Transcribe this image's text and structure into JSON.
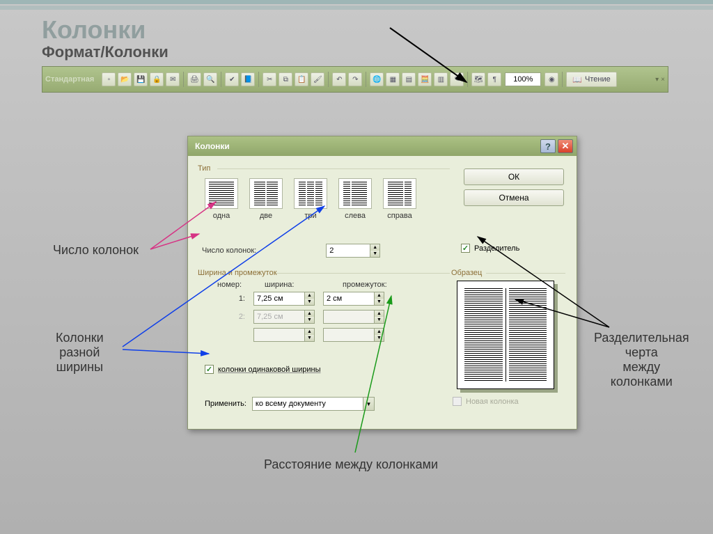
{
  "slide": {
    "title": "Колонки",
    "subtitle": "Формат/Колонки"
  },
  "toolbar": {
    "caption": "Стандартная",
    "zoom": "100%",
    "read_label": "Чтение"
  },
  "dialog": {
    "title": "Колонки",
    "type_label": "Тип",
    "types": {
      "one": "одна",
      "two": "две",
      "three": "три",
      "left": "слева",
      "right": "справа"
    },
    "ok": "ОК",
    "cancel": "Отмена",
    "numcols_label": "Число колонок:",
    "numcols_value": "2",
    "separator_label": "Разделитель",
    "width_group": "Ширина и промежуток",
    "col_number": "номер:",
    "col_width": "ширина:",
    "col_gap": "промежуток:",
    "row1_idx": "1:",
    "row1_width": "7,25 см",
    "row1_gap": "2 см",
    "row2_idx": "2:",
    "row2_width": "7,25 см",
    "row2_gap": "",
    "equal_width": "колонки одинаковой ширины",
    "apply_label": "Применить:",
    "apply_value": "ко всему документу",
    "preview_label": "Образец",
    "new_col": "Новая колонка"
  },
  "callouts": {
    "count": "Число колонок",
    "diff_width": "Колонки\nразной\nширины",
    "gap": "Расстояние между колонками",
    "sep_line": "Разделительная\nчерта\nмежду\nколонками"
  }
}
